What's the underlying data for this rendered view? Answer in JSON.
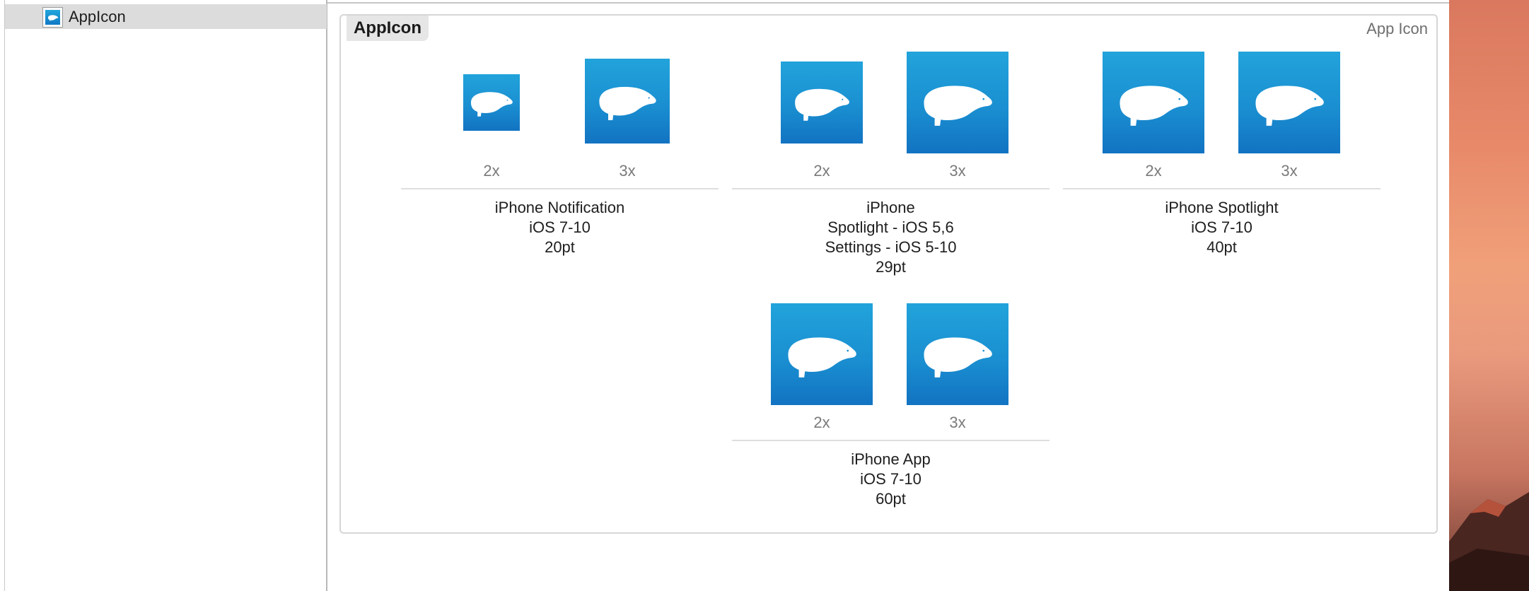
{
  "navigator": {
    "selected_item": "AppIcon"
  },
  "asset": {
    "name": "AppIcon",
    "type": "App Icon"
  },
  "groups": [
    {
      "scales": [
        "2x",
        "3x"
      ],
      "lines": [
        "iPhone Notification",
        "iOS 7-10",
        "20pt"
      ]
    },
    {
      "scales": [
        "2x",
        "3x"
      ],
      "lines": [
        "iPhone",
        "Spotlight - iOS 5,6",
        "Settings - iOS 5-10",
        "29pt"
      ]
    },
    {
      "scales": [
        "2x",
        "3x"
      ],
      "lines": [
        "iPhone Spotlight",
        "iOS 7-10",
        "40pt"
      ]
    },
    {
      "scales": [
        "2x",
        "3x"
      ],
      "lines": [
        "iPhone App",
        "iOS 7-10",
        "60pt"
      ]
    }
  ],
  "colors": {
    "icon_top": "#22a3db",
    "icon_bottom": "#1273c2",
    "selection": "#dcdcdc"
  },
  "icon_motif": "polar-bear-icon"
}
